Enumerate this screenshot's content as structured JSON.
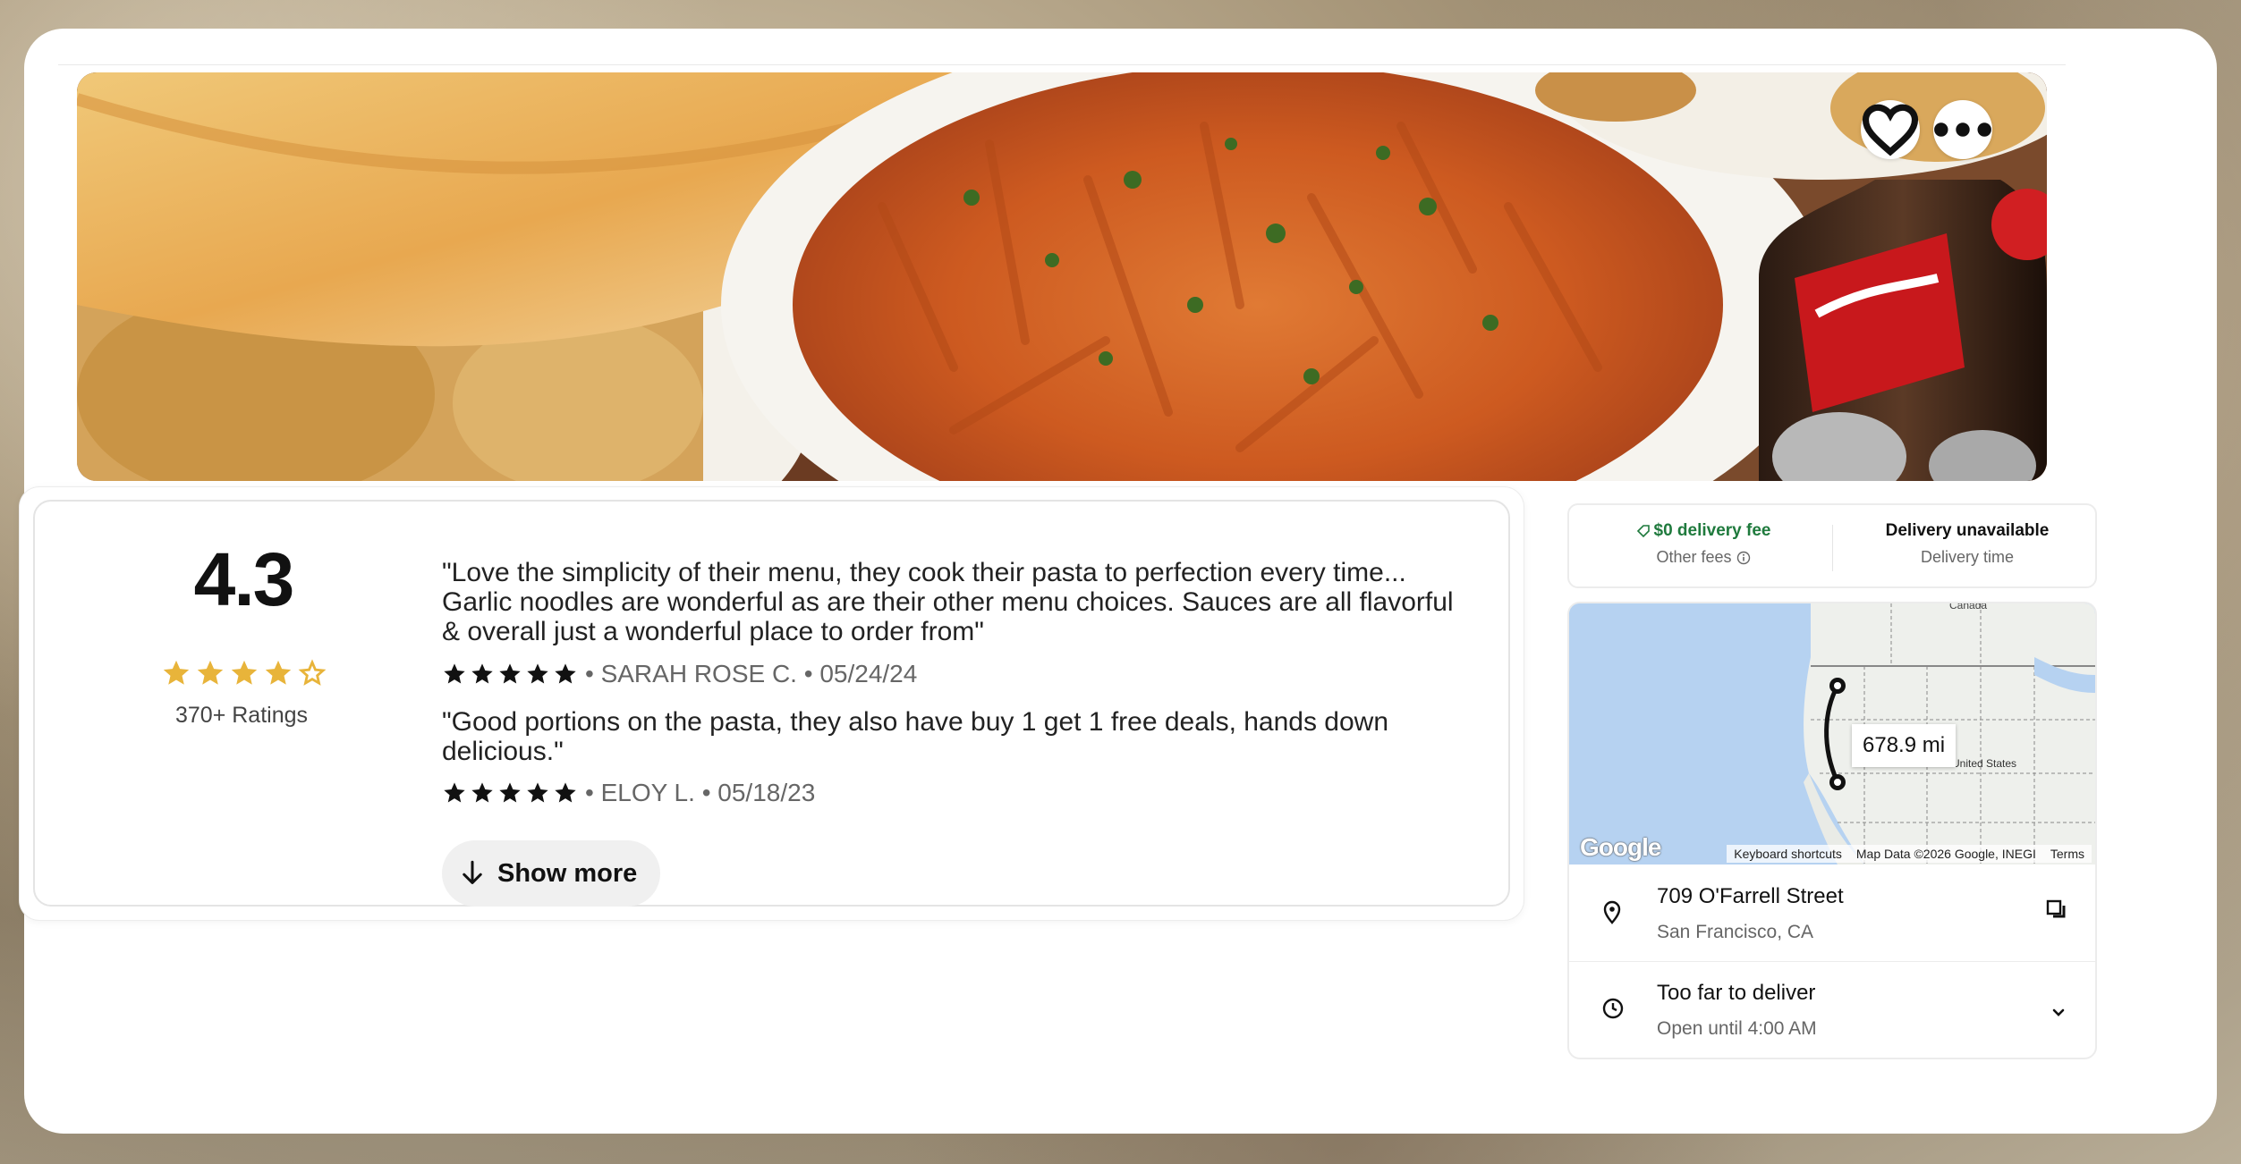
{
  "hero": {
    "favorite_icon": "heart-icon",
    "more_icon": "ellipsis-icon"
  },
  "ratings": {
    "score": "4.3",
    "star_count": 4.5,
    "count_label": "370+ Ratings"
  },
  "reviews": [
    {
      "text": "\"Love the simplicity of their menu, they cook their pasta to perfection every time... Garlic noodles are wonderful as are their other menu choices. Sauces are all flavorful & overall just a wonderful place to order from\"",
      "stars": 5,
      "meta": "• SARAH ROSE C. • 05/24/24"
    },
    {
      "text": "\"Good portions on the pasta, they also have buy 1 get 1 free deals, hands down delicious.\"",
      "stars": 5,
      "meta": "• ELOY L. • 05/18/23"
    }
  ],
  "show_more_label": "Show more",
  "delivery": {
    "fee_label": "$0 delivery fee",
    "fees_sub": "Other fees",
    "status_label": "Delivery unavailable",
    "status_sub": "Delivery time"
  },
  "map": {
    "distance": "678.9 mi",
    "label_country": "United States",
    "label_canada": "Canada",
    "google": "Google",
    "footer": [
      "Keyboard shortcuts",
      "Map Data ©2026 Google, INEGI",
      "Terms"
    ]
  },
  "location": {
    "street": "709 O'Farrell Street",
    "city": "San Francisco, CA"
  },
  "hours": {
    "status": "Too far to deliver",
    "open_until": "Open until 4:00 AM"
  },
  "colors": {
    "star_gold": "#e8b43a",
    "fee_green": "#1f7a3d"
  }
}
